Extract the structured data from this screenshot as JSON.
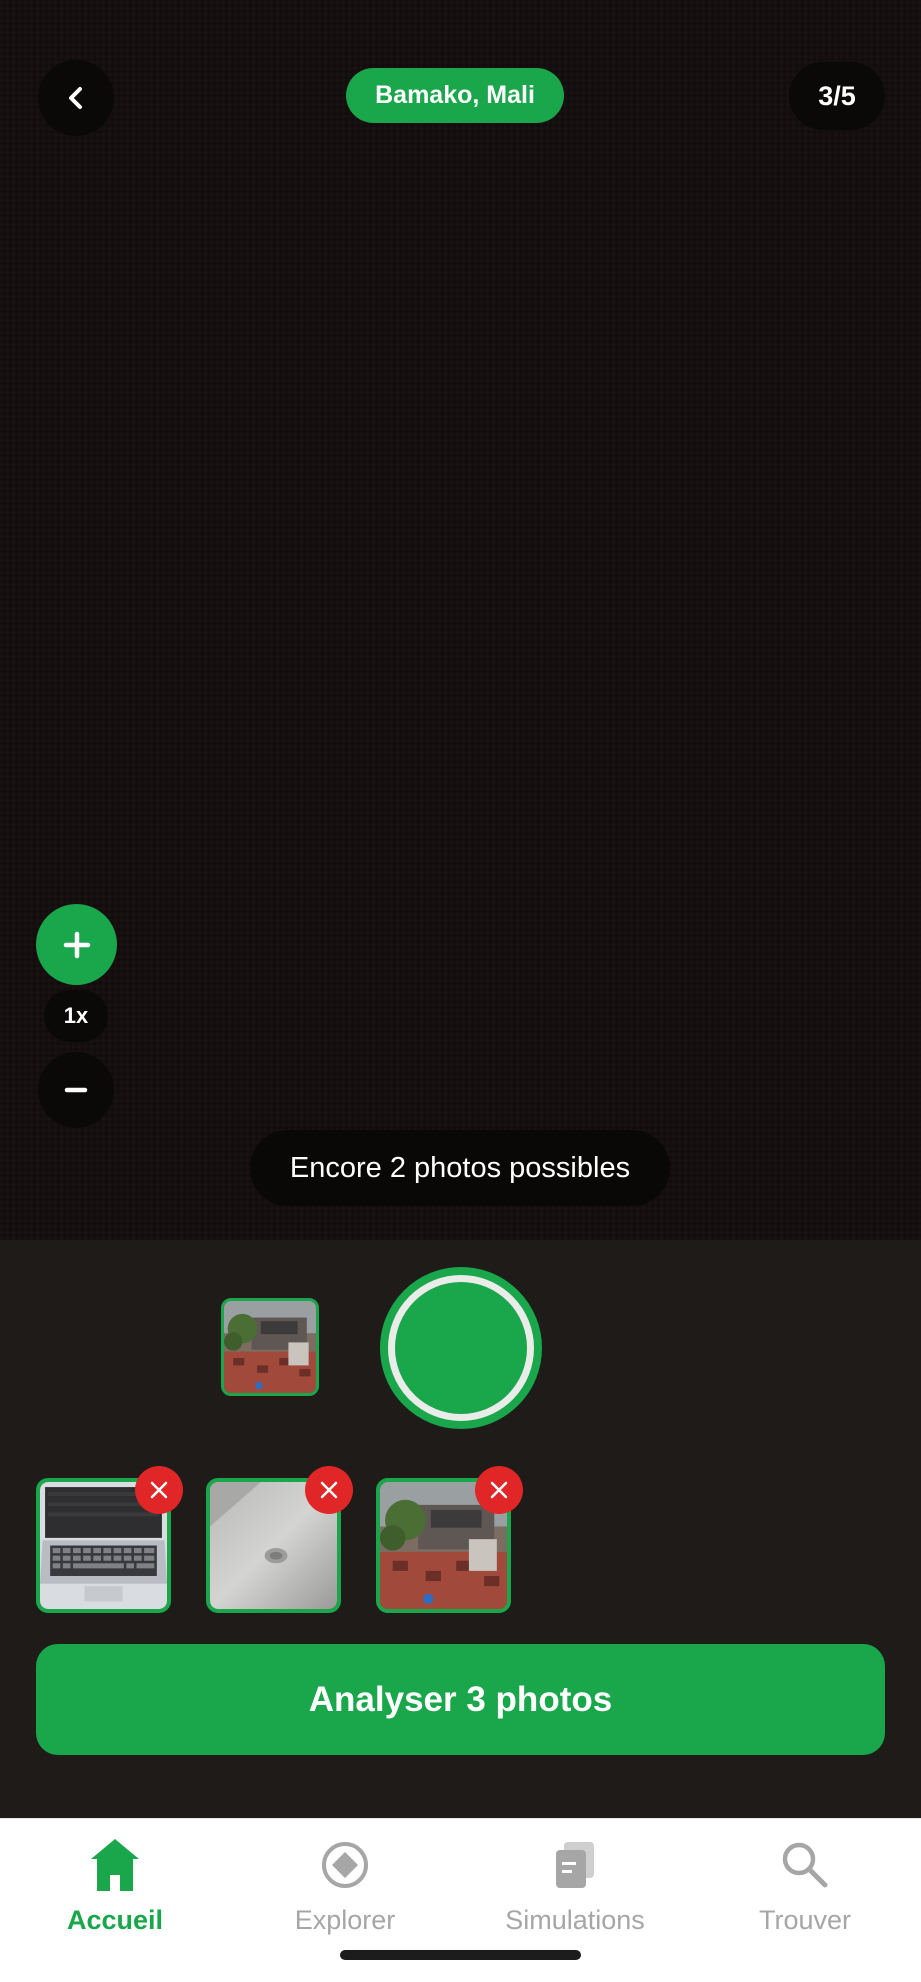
{
  "header": {
    "back_icon": "chevron-left-icon",
    "location": "Bamako, Mali",
    "photo_counter": "3/5"
  },
  "zoom": {
    "zoom_in_icon": "plus-icon",
    "level": "1x",
    "zoom_out_icon": "minus-icon"
  },
  "hint": "Encore 2 photos possibles",
  "capture": {
    "shutter_icon": "shutter-button",
    "last_photo_icon": "last-photo-thumbnail"
  },
  "selected_photos": [
    {
      "icon": "laptop-photo",
      "remove_icon": "close-icon"
    },
    {
      "icon": "ceiling-photo",
      "remove_icon": "close-icon"
    },
    {
      "icon": "courtyard-photo",
      "remove_icon": "close-icon"
    }
  ],
  "analyze_button": "Analyser 3 photos",
  "tabs": [
    {
      "label": "Accueil",
      "icon": "home-icon",
      "active": true
    },
    {
      "label": "Explorer",
      "icon": "compass-icon",
      "active": false
    },
    {
      "label": "Simulations",
      "icon": "document-stack-icon",
      "active": false
    },
    {
      "label": "Trouver",
      "icon": "search-icon",
      "active": false
    }
  ],
  "colors": {
    "accent": "#1aa64b",
    "remove": "#e02626",
    "panel": "#1e1b19",
    "tab_inactive": "#a6a6a6"
  }
}
